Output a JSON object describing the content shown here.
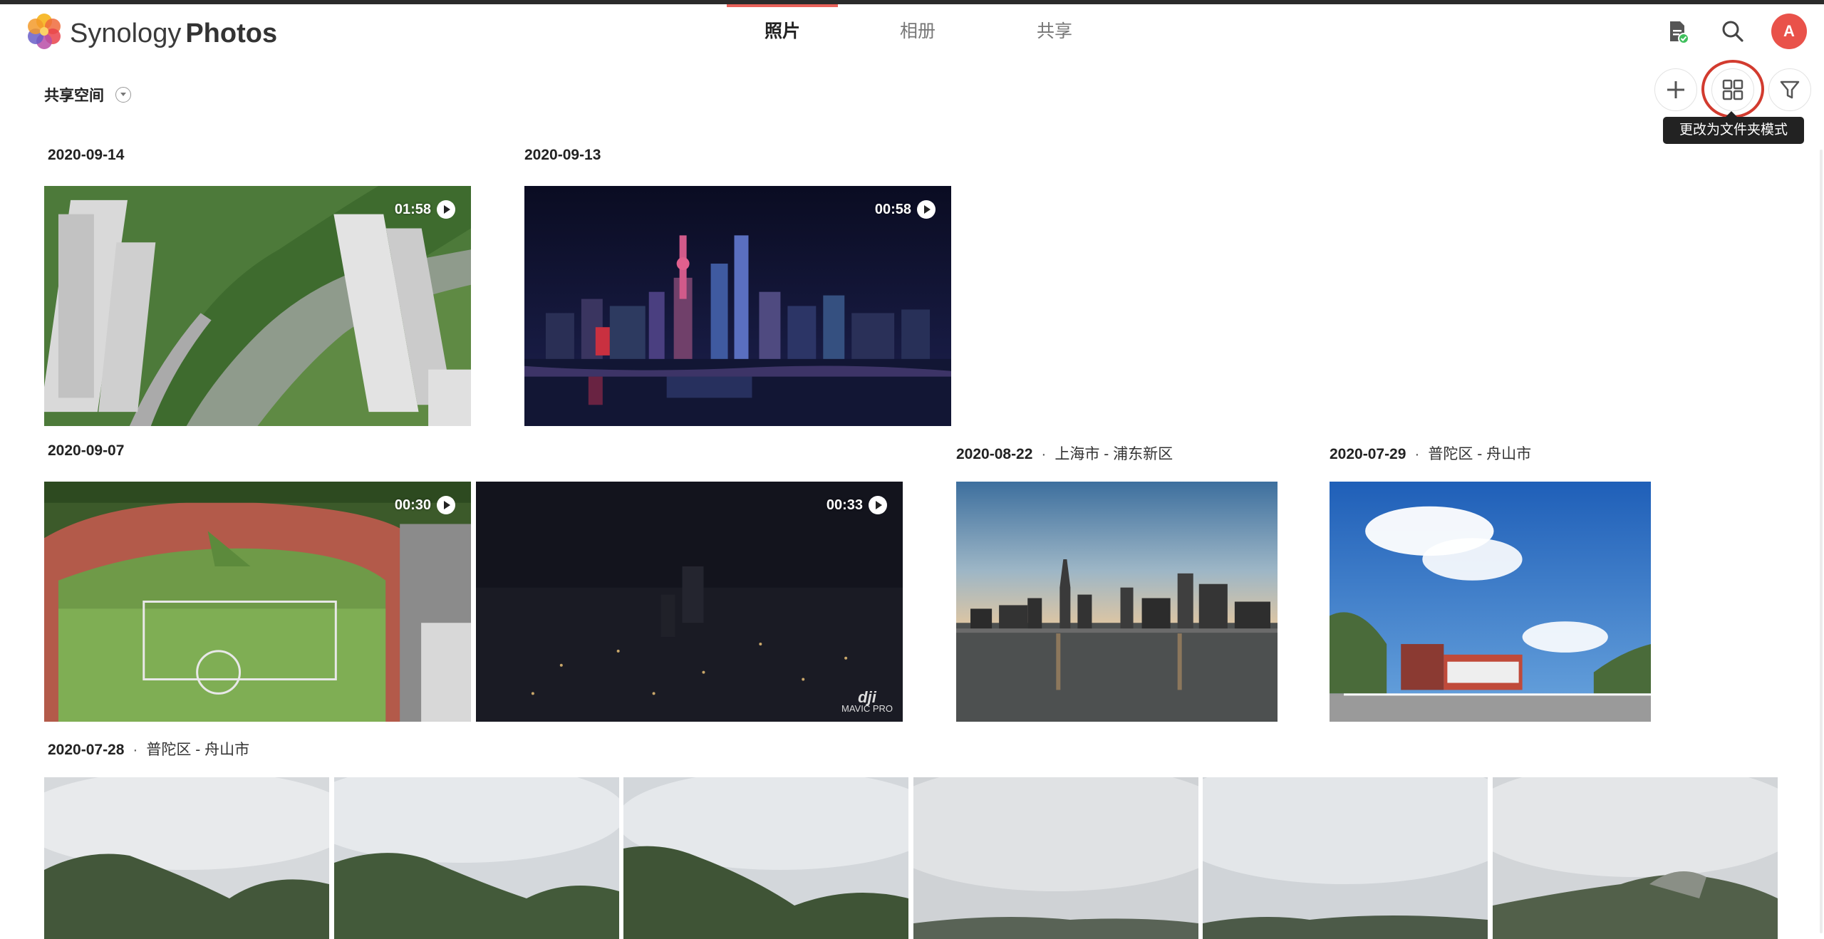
{
  "app": {
    "brand_part1": "Synology",
    "brand_part2": "Photos",
    "accent_color": "#e8615a"
  },
  "nav": {
    "tabs": [
      {
        "label": "照片",
        "active": true
      },
      {
        "label": "相册",
        "active": false
      },
      {
        "label": "共享",
        "active": false
      }
    ]
  },
  "header_icons": {
    "tasks": "task-icon",
    "search": "search-icon",
    "avatar_letter": "A"
  },
  "toolbar": {
    "space_label": "共享空间",
    "add": "plus-icon",
    "view": "grid-icon",
    "filter": "filter-icon",
    "tooltip": "更改为文件夹模式"
  },
  "groups": [
    {
      "date": "2020-09-14",
      "location": "",
      "items": [
        {
          "type": "video",
          "duration": "01:58"
        }
      ]
    },
    {
      "date": "2020-09-13",
      "location": "",
      "items": [
        {
          "type": "video",
          "duration": "00:58"
        }
      ]
    },
    {
      "date": "2020-09-07",
      "location": "",
      "items": [
        {
          "type": "video",
          "duration": "00:30"
        },
        {
          "type": "video",
          "duration": "00:33",
          "watermark_logo": "dji",
          "watermark_text": "MAVIC PRO"
        }
      ]
    },
    {
      "date": "2020-08-22",
      "location": "上海市 - 浦东新区",
      "items": [
        {
          "type": "photo"
        }
      ]
    },
    {
      "date": "2020-07-29",
      "location": "普陀区 - 舟山市",
      "items": [
        {
          "type": "photo"
        }
      ]
    },
    {
      "date": "2020-07-28",
      "location": "普陀区 - 舟山市",
      "items": [
        {
          "type": "photo"
        },
        {
          "type": "photo"
        },
        {
          "type": "photo"
        },
        {
          "type": "photo"
        },
        {
          "type": "photo"
        },
        {
          "type": "photo"
        }
      ]
    }
  ]
}
